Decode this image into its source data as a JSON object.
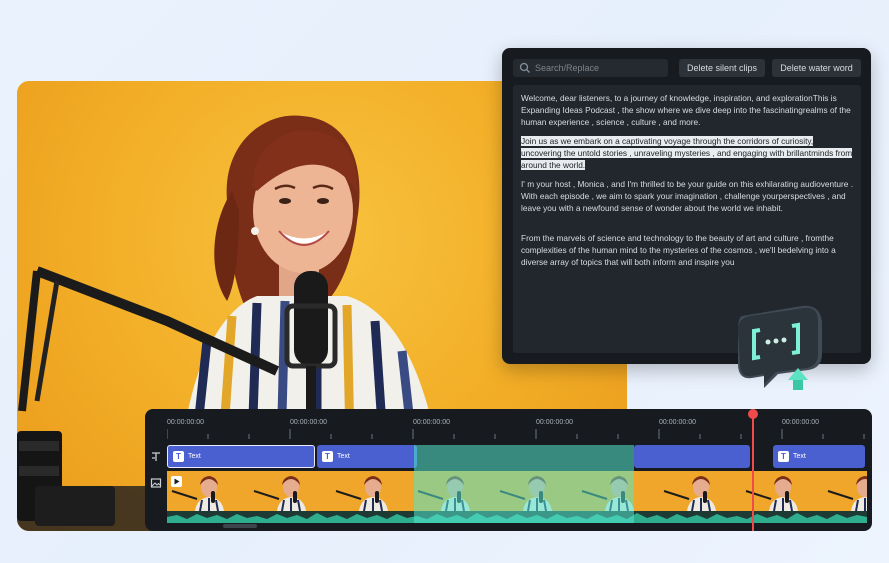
{
  "editor": {
    "search_placeholder": "Search/Replace",
    "delete_silent_label": "Delete silent clips",
    "delete_water_label": "Delete water word",
    "paragraphs": {
      "p1": "Welcome, dear listeners, to a journey of knowledge, inspiration, and explorationThis is Expanding Ideas Podcast , the show where we dive deep into the fascinatingrealms of the human experience , science , culture , and more.",
      "p2": "Join us as we embark on a captivating voyage through the corridors of curiosity, uncovering the untold stories , unraveling mysteries , and engaging with brillantminds from around the world.",
      "p3": "I' m your host , Monica , and I'm thrilled to be your guide on this exhilarating audioventure . With each episode , we aim to spark your imagination , challenge yourperspectives , and leave you with a newfound sense of wonder about the world we inhabit.",
      "p4": "From the marvels of science and technology to the beauty of art and culture , fromthe complexities of the human mind to the mysteries of the cosmos , we'll bedelving into a diverse array of topics that will both inform and inspire you"
    }
  },
  "timeline": {
    "timecodes": [
      "00:00:00:00",
      "00:00:00:00",
      "00:00:00:00",
      "00:00:00:00",
      "00:00:00:00",
      "00:00:00:00"
    ],
    "text_clips": [
      "Text",
      "Text",
      "Text"
    ]
  },
  "colors": {
    "accent_blue": "#4a5fd0",
    "selection_teal": "#54e6cd",
    "playhead_red": "#f04b4b",
    "background_yellow": "#f2ad26"
  },
  "icons": [
    "search-icon",
    "text-track-icon",
    "image-track-icon",
    "play-icon",
    "bracket-bubble-icon",
    "upload-arrow-icon"
  ]
}
